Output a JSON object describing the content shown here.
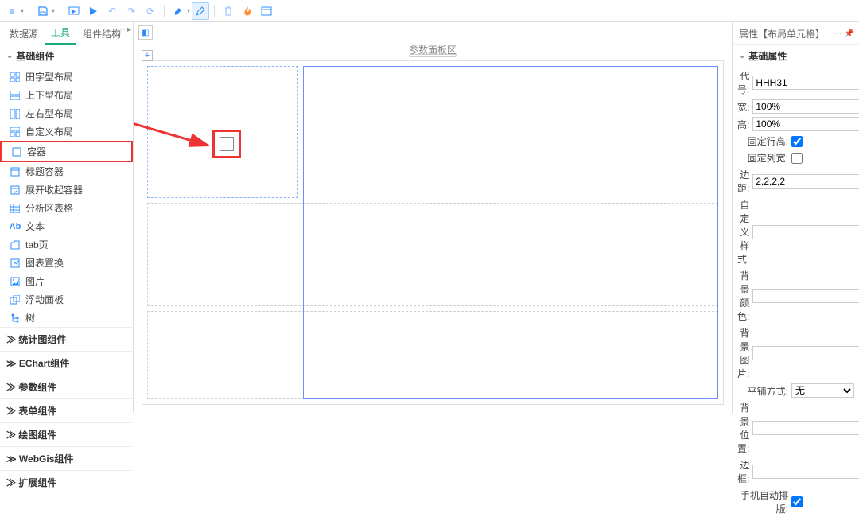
{
  "toolbar": {
    "icons": [
      "menu",
      "save",
      "preview",
      "play",
      "undo",
      "redo",
      "refresh",
      "paint",
      "pencil",
      "trash",
      "flame",
      "window"
    ]
  },
  "leftTabs": {
    "t0": "数据源",
    "t1": "工具",
    "t2": "组件结构"
  },
  "groups": {
    "basic": "基础组件",
    "stat": "统计图组件",
    "echart": "EChart组件",
    "param": "参数组件",
    "form": "表单组件",
    "paint": "绘图组件",
    "webgis": "WebGis组件",
    "ext": "扩展组件"
  },
  "basicItems": {
    "i0": "田字型布局",
    "i1": "上下型布局",
    "i2": "左右型布局",
    "i3": "自定义布局",
    "i4": "容器",
    "i5": "标题容器",
    "i6": "展开收起容器",
    "i7": "分析区表格",
    "i8": "文本",
    "i9": "tab页",
    "i10": "图表置换",
    "i11": "图片",
    "i12": "浮动面板",
    "i13": "树"
  },
  "canvas": {
    "paramTitle": "参数面板区"
  },
  "propsTitle": "属性【布局单元格】",
  "propsGroup": "基础属性",
  "props": {
    "code_l": "代号:",
    "code_v": "HHH31",
    "width_l": "宽:",
    "width_v": "100%",
    "height_l": "高:",
    "height_v": "100%",
    "fixrow_l": "固定行高:",
    "fixrow_v": true,
    "fixcol_l": "固定列宽:",
    "fixcol_v": false,
    "margin_l": "边距:",
    "margin_v": "2,2,2,2",
    "custom_l": "自定义样式:",
    "bgcolor_l": "背景颜色:",
    "bgimg_l": "背景图片:",
    "tile_l": "平铺方式:",
    "tile_v": "无",
    "bgpos_l": "背景位置:",
    "border_l": "边框:",
    "mobile_l": "手机自动排版:",
    "mobile_v": true
  }
}
